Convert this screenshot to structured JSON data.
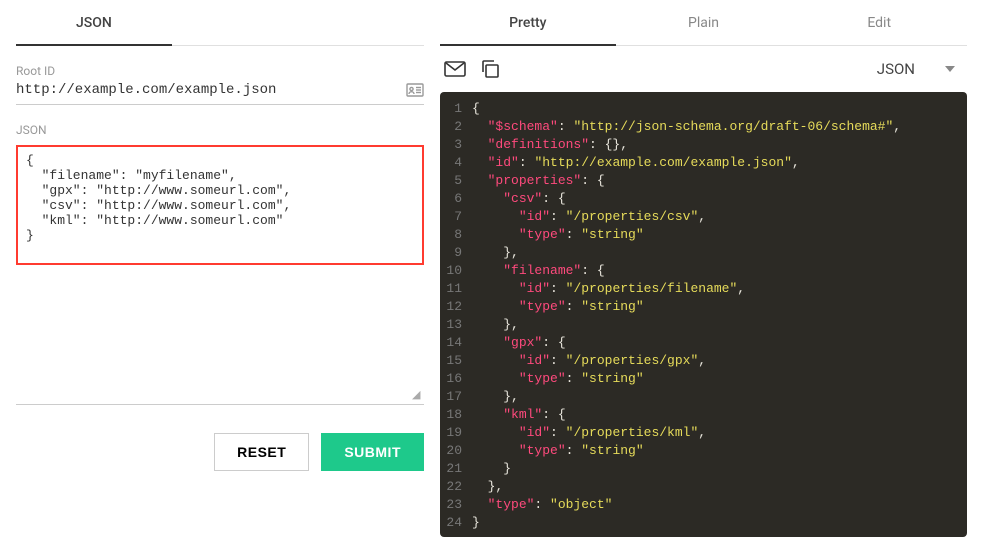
{
  "leftTabs": [
    {
      "label": "JSON",
      "active": true
    }
  ],
  "rightTabs": [
    {
      "label": "Pretty",
      "active": true
    },
    {
      "label": "Plain",
      "active": false
    },
    {
      "label": "Edit",
      "active": false
    }
  ],
  "rootId": {
    "label": "Root ID",
    "value": "http://example.com/example.json"
  },
  "jsonInput": {
    "label": "JSON",
    "value": "{\n  \"filename\": \"myfilename\",\n  \"gpx\": \"http://www.someurl.com\",\n  \"csv\": \"http://www.someurl.com\",\n  \"kml\": \"http://www.someurl.com\"\n}"
  },
  "buttons": {
    "reset": "RESET",
    "submit": "SUBMIT"
  },
  "formatSelect": "JSON",
  "codeLines": [
    [
      {
        "t": "punc",
        "v": "{"
      }
    ],
    [
      {
        "t": "ind",
        "v": "  "
      },
      {
        "t": "key",
        "v": "\"$schema\""
      },
      {
        "t": "punc",
        "v": ": "
      },
      {
        "t": "str",
        "v": "\"http://json-schema.org/draft-06/schema#\""
      },
      {
        "t": "punc",
        "v": ","
      }
    ],
    [
      {
        "t": "ind",
        "v": "  "
      },
      {
        "t": "key",
        "v": "\"definitions\""
      },
      {
        "t": "punc",
        "v": ": {},"
      }
    ],
    [
      {
        "t": "ind",
        "v": "  "
      },
      {
        "t": "key",
        "v": "\"id\""
      },
      {
        "t": "punc",
        "v": ": "
      },
      {
        "t": "str",
        "v": "\"http://example.com/example.json\""
      },
      {
        "t": "punc",
        "v": ","
      }
    ],
    [
      {
        "t": "ind",
        "v": "  "
      },
      {
        "t": "key",
        "v": "\"properties\""
      },
      {
        "t": "punc",
        "v": ": {"
      }
    ],
    [
      {
        "t": "ind",
        "v": "    "
      },
      {
        "t": "key",
        "v": "\"csv\""
      },
      {
        "t": "punc",
        "v": ": {"
      }
    ],
    [
      {
        "t": "ind",
        "v": "      "
      },
      {
        "t": "key",
        "v": "\"id\""
      },
      {
        "t": "punc",
        "v": ": "
      },
      {
        "t": "str",
        "v": "\"/properties/csv\""
      },
      {
        "t": "punc",
        "v": ","
      }
    ],
    [
      {
        "t": "ind",
        "v": "      "
      },
      {
        "t": "key",
        "v": "\"type\""
      },
      {
        "t": "punc",
        "v": ": "
      },
      {
        "t": "str",
        "v": "\"string\""
      }
    ],
    [
      {
        "t": "ind",
        "v": "    "
      },
      {
        "t": "punc",
        "v": "},"
      }
    ],
    [
      {
        "t": "ind",
        "v": "    "
      },
      {
        "t": "key",
        "v": "\"filename\""
      },
      {
        "t": "punc",
        "v": ": {"
      }
    ],
    [
      {
        "t": "ind",
        "v": "      "
      },
      {
        "t": "key",
        "v": "\"id\""
      },
      {
        "t": "punc",
        "v": ": "
      },
      {
        "t": "str",
        "v": "\"/properties/filename\""
      },
      {
        "t": "punc",
        "v": ","
      }
    ],
    [
      {
        "t": "ind",
        "v": "      "
      },
      {
        "t": "key",
        "v": "\"type\""
      },
      {
        "t": "punc",
        "v": ": "
      },
      {
        "t": "str",
        "v": "\"string\""
      }
    ],
    [
      {
        "t": "ind",
        "v": "    "
      },
      {
        "t": "punc",
        "v": "},"
      }
    ],
    [
      {
        "t": "ind",
        "v": "    "
      },
      {
        "t": "key",
        "v": "\"gpx\""
      },
      {
        "t": "punc",
        "v": ": {"
      }
    ],
    [
      {
        "t": "ind",
        "v": "      "
      },
      {
        "t": "key",
        "v": "\"id\""
      },
      {
        "t": "punc",
        "v": ": "
      },
      {
        "t": "str",
        "v": "\"/properties/gpx\""
      },
      {
        "t": "punc",
        "v": ","
      }
    ],
    [
      {
        "t": "ind",
        "v": "      "
      },
      {
        "t": "key",
        "v": "\"type\""
      },
      {
        "t": "punc",
        "v": ": "
      },
      {
        "t": "str",
        "v": "\"string\""
      }
    ],
    [
      {
        "t": "ind",
        "v": "    "
      },
      {
        "t": "punc",
        "v": "},"
      }
    ],
    [
      {
        "t": "ind",
        "v": "    "
      },
      {
        "t": "key",
        "v": "\"kml\""
      },
      {
        "t": "punc",
        "v": ": {"
      }
    ],
    [
      {
        "t": "ind",
        "v": "      "
      },
      {
        "t": "key",
        "v": "\"id\""
      },
      {
        "t": "punc",
        "v": ": "
      },
      {
        "t": "str",
        "v": "\"/properties/kml\""
      },
      {
        "t": "punc",
        "v": ","
      }
    ],
    [
      {
        "t": "ind",
        "v": "      "
      },
      {
        "t": "key",
        "v": "\"type\""
      },
      {
        "t": "punc",
        "v": ": "
      },
      {
        "t": "str",
        "v": "\"string\""
      }
    ],
    [
      {
        "t": "ind",
        "v": "    "
      },
      {
        "t": "punc",
        "v": "}"
      }
    ],
    [
      {
        "t": "ind",
        "v": "  "
      },
      {
        "t": "punc",
        "v": "},"
      }
    ],
    [
      {
        "t": "ind",
        "v": "  "
      },
      {
        "t": "key",
        "v": "\"type\""
      },
      {
        "t": "punc",
        "v": ": "
      },
      {
        "t": "str",
        "v": "\"object\""
      }
    ],
    [
      {
        "t": "punc",
        "v": "}"
      }
    ]
  ]
}
